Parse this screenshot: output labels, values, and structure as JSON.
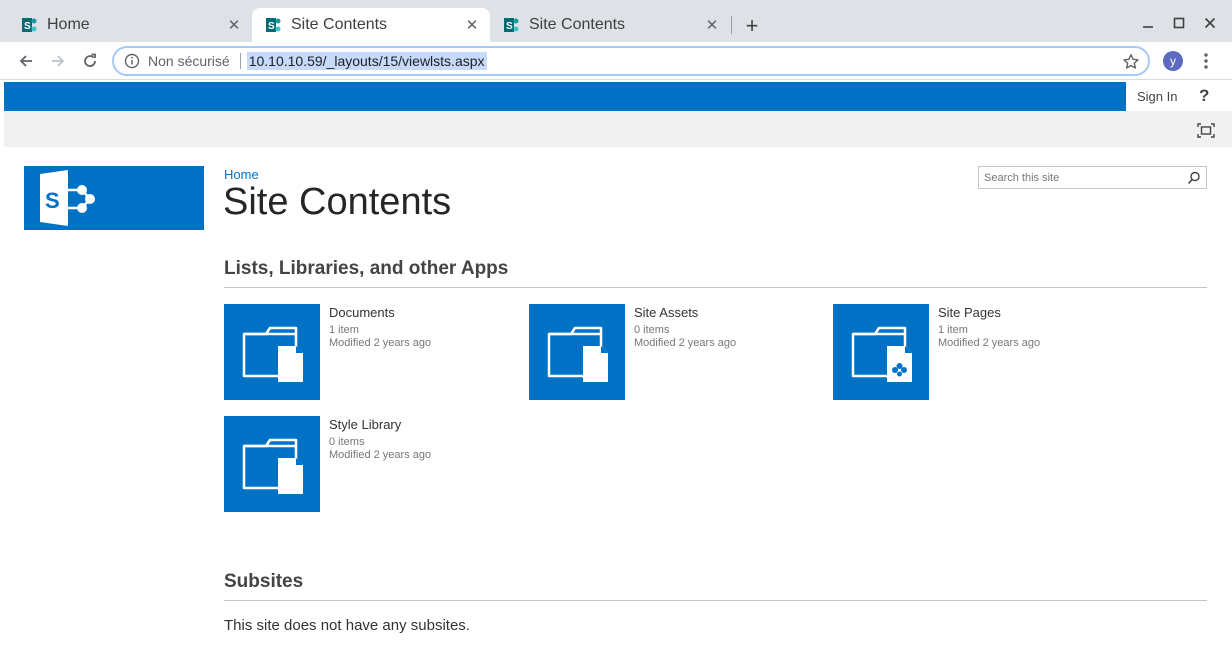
{
  "browser": {
    "tabs": [
      {
        "title": "Home",
        "active": false
      },
      {
        "title": "Site Contents",
        "active": true
      },
      {
        "title": "Site Contents",
        "active": false
      }
    ],
    "omnibox": {
      "security_label": "Non sécurisé",
      "url": "10.10.10.59/_layouts/15/viewlsts.aspx"
    },
    "profile_initial": "y"
  },
  "suitebar": {
    "sign_in_label": "Sign In",
    "help_label": "?"
  },
  "page": {
    "breadcrumb": "Home",
    "title": "Site Contents",
    "search_placeholder": "Search this site"
  },
  "lists_section": {
    "heading": "Lists, Libraries, and other Apps",
    "apps": [
      {
        "name": "Documents",
        "count": "1 item",
        "modified": "Modified 2 years ago",
        "icon": "document-library-icon"
      },
      {
        "name": "Site Assets",
        "count": "0 items",
        "modified": "Modified 2 years ago",
        "icon": "document-library-icon"
      },
      {
        "name": "Site Pages",
        "count": "1 item",
        "modified": "Modified 2 years ago",
        "icon": "wiki-page-library-icon"
      },
      {
        "name": "Style Library",
        "count": "0 items",
        "modified": "Modified 2 years ago",
        "icon": "document-library-icon"
      }
    ]
  },
  "subsites_section": {
    "heading": "Subsites",
    "empty_message": "This site does not have any subsites."
  },
  "colors": {
    "sharepoint_blue": "#0072c6",
    "ribbon_gray": "#f1f1f1",
    "tabstrip_gray": "#dee1e6"
  }
}
